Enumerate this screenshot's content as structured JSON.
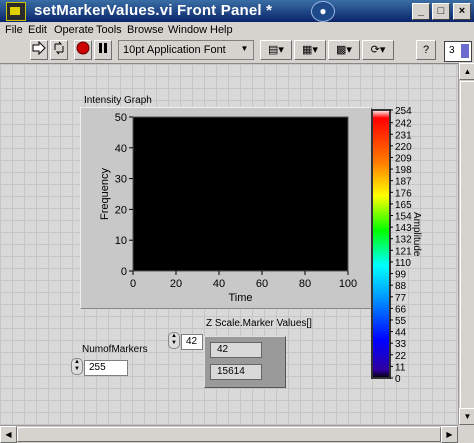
{
  "window": {
    "title": "setMarkerValues.vi Front Panel *"
  },
  "title_buttons": [
    "_",
    "□",
    "×"
  ],
  "menu": [
    "File",
    "Edit",
    "Operate",
    "Tools",
    "Browse",
    "Window",
    "Help"
  ],
  "toolbar": {
    "font_selector": "10pt Application Font"
  },
  "connector_pane": {
    "number": "3"
  },
  "colors": {
    "plot_bg": "#000000",
    "frame": "#c8c8c8",
    "panel_grid": "#c5c5c5"
  },
  "controls": {
    "num_of_markers": {
      "label": "NumofMarkers",
      "value": "255"
    },
    "array_index": {
      "value": "42"
    },
    "z_scale_marker_values": {
      "label": "Z Scale.Marker Values[]",
      "values": [
        "42",
        "15614"
      ]
    }
  },
  "chart_data": {
    "type": "heatmap",
    "title": "Intensity Graph",
    "xlabel": "Time",
    "ylabel": "Frequency",
    "xlim": [
      0,
      100
    ],
    "ylim": [
      0,
      50
    ],
    "xticks": [
      "0",
      "20",
      "40",
      "60",
      "80",
      "100"
    ],
    "yticks": [
      "0",
      "10",
      "20",
      "30",
      "40",
      "50"
    ],
    "z_label": "Amplitude",
    "zlim": [
      0,
      254
    ],
    "zticks": [
      "0",
      "11",
      "22",
      "33",
      "44",
      "55",
      "66",
      "77",
      "88",
      "99",
      "110",
      "121",
      "132",
      "143",
      "154",
      "165",
      "176",
      "187",
      "198",
      "209",
      "220",
      "231",
      "242",
      "254"
    ],
    "values": []
  }
}
